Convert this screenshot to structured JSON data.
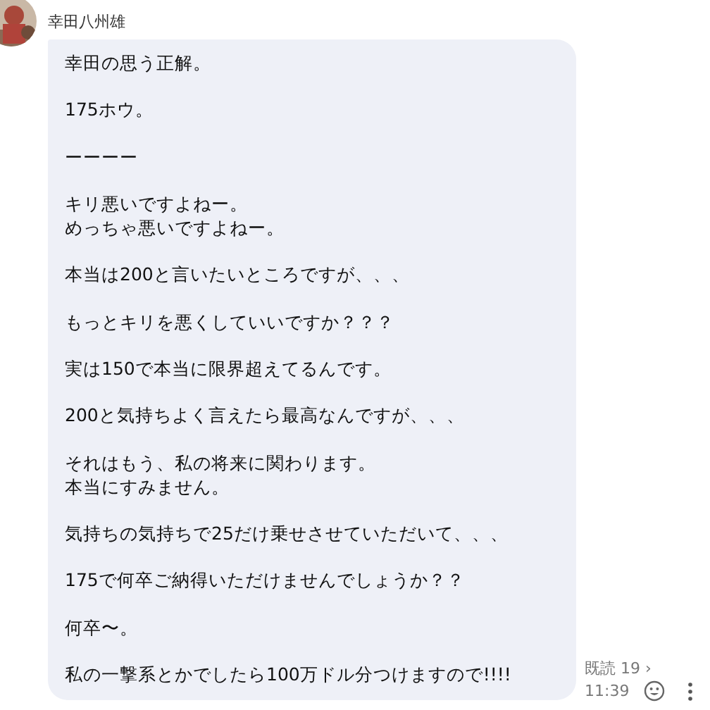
{
  "sender": {
    "name": "幸田八州雄"
  },
  "message": {
    "paragraphs": [
      [
        "幸田の思う正解。"
      ],
      [
        "175ホウ。"
      ],
      [
        "ーーーー"
      ],
      [
        "キリ悪いですよねー。",
        "めっちゃ悪いですよねー。"
      ],
      [
        "本当は200と言いたいところですが、、、"
      ],
      [
        "もっとキリを悪くしていいですか？？？"
      ],
      [
        "実は150で本当に限界超えてるんです。"
      ],
      [
        "200と気持ちよく言えたら最高なんですが、、、"
      ],
      [
        "それはもう、私の将来に関わります。",
        "本当にすみません。"
      ],
      [
        "気持ちの気持ちで25だけ乗せさせていただいて、、、"
      ],
      [
        "175で何卒ご納得いただけませんでしょうか？？"
      ],
      [
        "何卒〜。"
      ],
      [
        "私の一撃系とかでしたら100万ドル分つけますので!!!!"
      ]
    ],
    "read_status": "既読 19 ›",
    "time": "11:39"
  }
}
